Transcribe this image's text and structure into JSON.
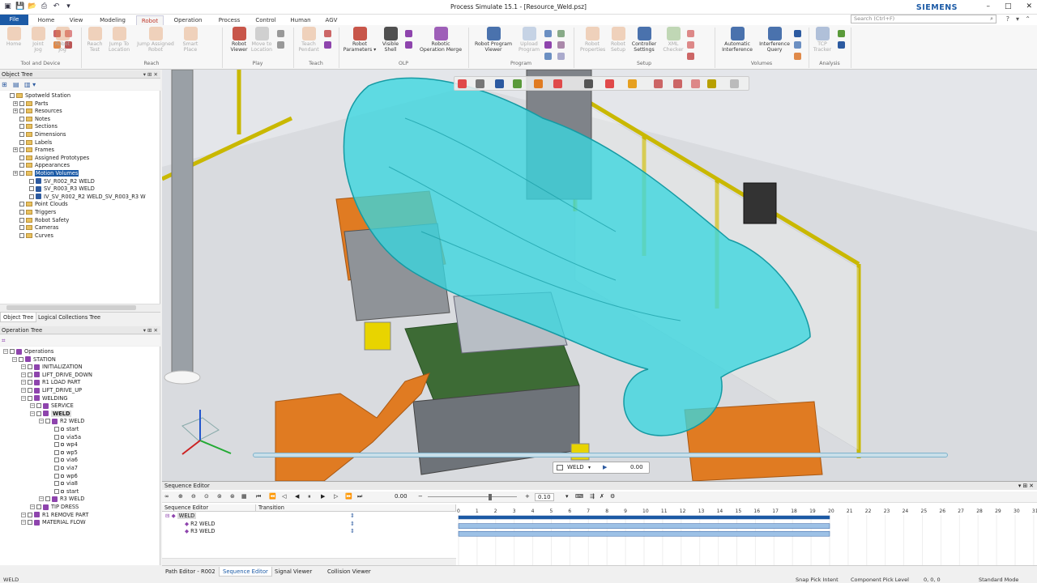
{
  "window": {
    "title": "Process Simulate 15.1 - [Resource_Weld.psz]",
    "brand": "SIEMENS",
    "search_placeholder": "Search (Ctrl+F)"
  },
  "menu": {
    "tabs": [
      "File",
      "Home",
      "View",
      "Modeling",
      "Robot",
      "Operation",
      "Process",
      "Control",
      "Human",
      "AGV"
    ],
    "active": "Robot"
  },
  "ribbon": {
    "buttons": [
      {
        "label": "Home",
        "label2": "",
        "enabled": false,
        "color": "#e08a4a"
      },
      {
        "label": "Joint",
        "label2": "Jog",
        "enabled": false,
        "color": "#e08a4a"
      },
      {
        "label": "Robot",
        "label2": "Jog",
        "enabled": false,
        "color": "#e08a4a"
      },
      {
        "label": "Reach",
        "label2": "Test",
        "enabled": false,
        "color": "#e08a4a"
      },
      {
        "label": "Jump To",
        "label2": "Location",
        "enabled": false,
        "color": "#e08a4a"
      },
      {
        "label": "Jump Assigned",
        "label2": "Robot",
        "enabled": false,
        "color": "#e08a4a"
      },
      {
        "label": "Smart",
        "label2": "Place",
        "enabled": false,
        "color": "#e08a4a"
      },
      {
        "label": "Robot",
        "label2": "Viewer",
        "enabled": true,
        "color": "#c0392b"
      },
      {
        "label": "Move to",
        "label2": "Location",
        "enabled": false,
        "color": "#888"
      },
      {
        "label": "Teach",
        "label2": "Pendant",
        "enabled": false,
        "color": "#e08a4a"
      },
      {
        "label": "Robot",
        "label2": "Parameters ▾",
        "enabled": true,
        "color": "#c0392b"
      },
      {
        "label": "Visible",
        "label2": "Shell",
        "enabled": true,
        "color": "#333"
      },
      {
        "label": "Robotic",
        "label2": "Operation Merge",
        "enabled": true,
        "color": "#8e44ad"
      },
      {
        "label": "Robot Program",
        "label2": "Viewer",
        "enabled": true,
        "color": "#2c5aa0"
      },
      {
        "label": "Upload",
        "label2": "Program",
        "enabled": false,
        "color": "#6b8fc2"
      },
      {
        "label": "Robot",
        "label2": "Properties",
        "enabled": false,
        "color": "#e08a4a"
      },
      {
        "label": "Robot",
        "label2": "Setup",
        "enabled": false,
        "color": "#e08a4a"
      },
      {
        "label": "Controller",
        "label2": "Settings",
        "enabled": true,
        "color": "#2c5aa0"
      },
      {
        "label": "XML",
        "label2": "Checker",
        "enabled": false,
        "color": "#5a9a3a"
      },
      {
        "label": "Automatic",
        "label2": "Interference",
        "enabled": true,
        "color": "#2c5aa0"
      },
      {
        "label": "Interference",
        "label2": "Query",
        "enabled": true,
        "color": "#2c5aa0"
      },
      {
        "label": "TCP",
        "label2": "Tracker",
        "enabled": false,
        "color": "#2c5aa0"
      }
    ],
    "groups": [
      "Tool and Device",
      "Reach",
      "Play",
      "Teach",
      "OLP",
      "Program",
      "Setup",
      "Volumes",
      "Analysis"
    ]
  },
  "object_tree": {
    "title": "Object Tree",
    "items": [
      {
        "label": "Spotweld Station",
        "depth": 0,
        "type": "root"
      },
      {
        "label": "Parts",
        "depth": 1,
        "type": "folder",
        "exp": true
      },
      {
        "label": "Resources",
        "depth": 1,
        "type": "folder",
        "exp": true
      },
      {
        "label": "Notes",
        "depth": 1,
        "type": "folder"
      },
      {
        "label": "Sections",
        "depth": 1,
        "type": "folder"
      },
      {
        "label": "Dimensions",
        "depth": 1,
        "type": "folder"
      },
      {
        "label": "Labels",
        "depth": 1,
        "type": "folder"
      },
      {
        "label": "Frames",
        "depth": 1,
        "type": "folder",
        "exp": true
      },
      {
        "label": "Assigned Prototypes",
        "depth": 1,
        "type": "folder"
      },
      {
        "label": "Appearances",
        "depth": 1,
        "type": "folder"
      },
      {
        "label": "Motion Volumes",
        "depth": 1,
        "type": "folder",
        "exp": true,
        "selected": true
      },
      {
        "label": "SV_R002_R2 WELD",
        "depth": 2,
        "type": "vol"
      },
      {
        "label": "SV_R003_R3 WELD",
        "depth": 2,
        "type": "vol"
      },
      {
        "label": "IV_SV_R002_R2 WELD_SV_R003_R3 W",
        "depth": 2,
        "type": "vol"
      },
      {
        "label": "Point Clouds",
        "depth": 1,
        "type": "folder"
      },
      {
        "label": "Triggers",
        "depth": 1,
        "type": "folder"
      },
      {
        "label": "Robot Safety",
        "depth": 1,
        "type": "folder"
      },
      {
        "label": "Cameras",
        "depth": 1,
        "type": "folder"
      },
      {
        "label": "Curves",
        "depth": 1,
        "type": "folder"
      }
    ],
    "tabs": [
      "Object Tree",
      "Logical Collections Tree"
    ]
  },
  "operation_tree": {
    "title": "Operation Tree",
    "items": [
      {
        "label": "Operations",
        "depth": 0
      },
      {
        "label": "STATION",
        "depth": 1
      },
      {
        "label": "INITIALIZATION",
        "depth": 2
      },
      {
        "label": "LIFT_DRIVE_DOWN",
        "depth": 2
      },
      {
        "label": "R1 LOAD PART",
        "depth": 2
      },
      {
        "label": "LIFT_DRIVE_UP",
        "depth": 2
      },
      {
        "label": "WELDING",
        "depth": 2
      },
      {
        "label": "SERVICE",
        "depth": 3
      },
      {
        "label": "WELD",
        "depth": 3,
        "bold": true
      },
      {
        "label": "R2 WELD",
        "depth": 4
      },
      {
        "label": "start",
        "depth": 5
      },
      {
        "label": "via5a",
        "depth": 5
      },
      {
        "label": "wp4",
        "depth": 5
      },
      {
        "label": "wp5",
        "depth": 5
      },
      {
        "label": "via6",
        "depth": 5
      },
      {
        "label": "via7",
        "depth": 5
      },
      {
        "label": "wp6",
        "depth": 5
      },
      {
        "label": "via8",
        "depth": 5
      },
      {
        "label": "start",
        "depth": 5
      },
      {
        "label": "R3 WELD",
        "depth": 4
      },
      {
        "label": "TIP DRESS",
        "depth": 3
      },
      {
        "label": "R1 REMOVE PART",
        "depth": 2
      },
      {
        "label": "MATERIAL FLOW",
        "depth": 2
      }
    ]
  },
  "viewport": {
    "playback_op": "WELD",
    "playback_time": "0.00"
  },
  "sequence_editor": {
    "title": "Sequence Editor",
    "time": "0.00",
    "step": "0.10",
    "columns": [
      "Sequence Editor",
      "Transition"
    ],
    "rows": [
      "WELD",
      "R2 WELD",
      "R3 WELD"
    ],
    "ticks": [
      "0",
      "1",
      "2",
      "3",
      "4",
      "5",
      "6",
      "7",
      "8",
      "9",
      "10",
      "11",
      "12",
      "13",
      "14",
      "15",
      "16",
      "17",
      "18",
      "19",
      "20",
      "21",
      "22",
      "23",
      "24",
      "25",
      "26",
      "27",
      "28",
      "29",
      "30",
      "31"
    ],
    "bars": [
      {
        "start": 0,
        "end": 20
      },
      {
        "start": 0,
        "end": 20
      },
      {
        "start": 0,
        "end": 20
      }
    ]
  },
  "bottom_tabs": [
    "Path Editor - R002",
    "Sequence Editor",
    "Signal Viewer",
    "Collision Viewer"
  ],
  "status": {
    "left": "WELD",
    "snap": "Snap Pick Intent",
    "component": "Component Pick Level",
    "coords": "0, 0, 0",
    "mode": "Standard Mode"
  }
}
